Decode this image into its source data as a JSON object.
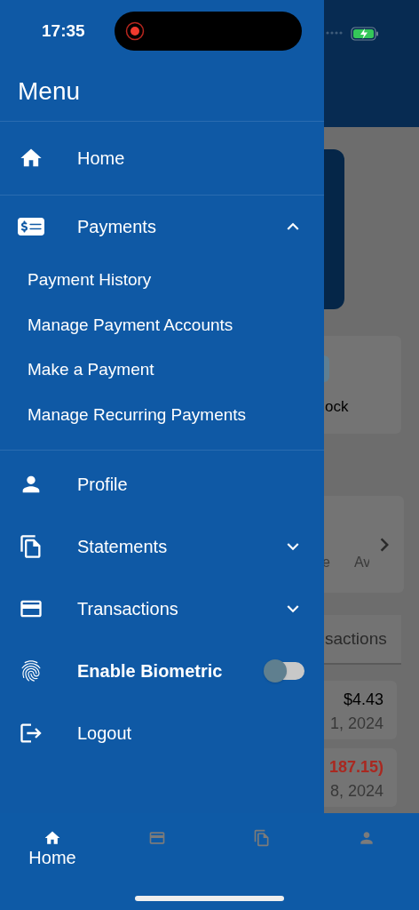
{
  "status_bar": {
    "time": "17:35",
    "recording": true
  },
  "drawer": {
    "title": "Menu",
    "items": [
      {
        "kind": "link",
        "label": "Home"
      },
      {
        "kind": "group",
        "label": "Payments",
        "expanded": true,
        "children": [
          {
            "label": "Payment History"
          },
          {
            "label": "Manage Payment Accounts"
          },
          {
            "label": "Make a Payment"
          },
          {
            "label": "Manage Recurring Payments"
          }
        ]
      },
      {
        "kind": "link",
        "label": "Profile"
      },
      {
        "kind": "group",
        "label": "Statements",
        "expanded": false
      },
      {
        "kind": "group",
        "label": "Transactions",
        "expanded": false
      },
      {
        "kind": "toggle",
        "label": "Enable Biometric",
        "on": false
      },
      {
        "kind": "link",
        "label": "Logout"
      }
    ]
  },
  "background": {
    "account_tile": {
      "text": "ock"
    },
    "summary_card": {
      "text_1": "e",
      "text_2": "Av"
    },
    "tab": {
      "label": "sactions"
    },
    "transactions": [
      {
        "amount": "$4.43",
        "date": "1, 2024",
        "negative": false
      },
      {
        "amount": "187.15)",
        "date": "8, 2024",
        "negative": true
      }
    ]
  },
  "bottom_nav": [
    {
      "label": "Home",
      "selected": true
    },
    {
      "selected": false
    },
    {
      "selected": false
    },
    {
      "selected": false
    }
  ]
}
